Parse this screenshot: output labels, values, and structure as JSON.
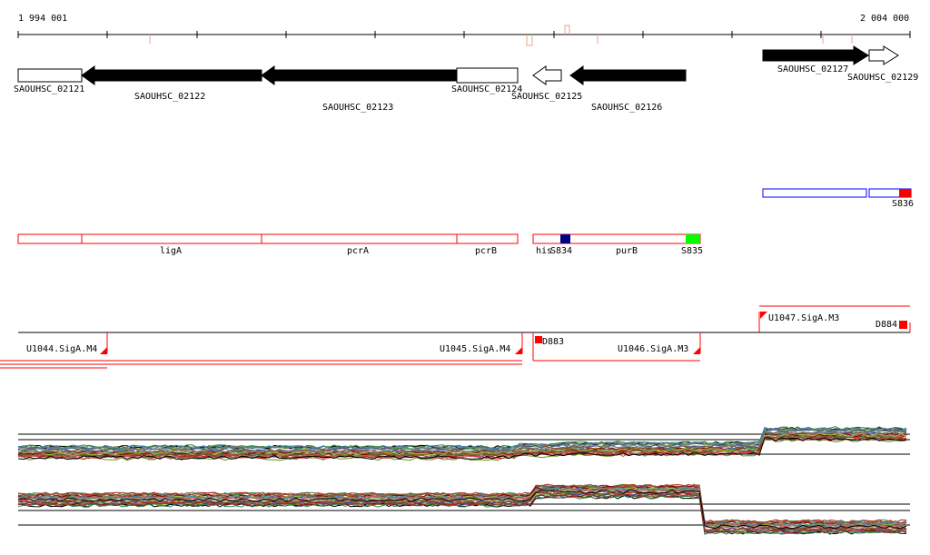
{
  "scale": {
    "start_label": "1 994 001",
    "end_label": "2 004 000",
    "start": 1994001,
    "end": 2004000
  },
  "colors": {
    "gene_fill": "#000000",
    "gene_outline": "#000000",
    "feature_red": "#ff0000",
    "feature_blue": "#0000ff",
    "feature_navy": "#000080",
    "feature_green": "#00ff00",
    "tick_salmon": "#e8a090"
  },
  "genes": [
    {
      "label": "SAOUHSC_02121",
      "strand": "+",
      "filled": false,
      "track": 0
    },
    {
      "label": "SAOUHSC_02122",
      "strand": "-",
      "filled": true,
      "track": 1
    },
    {
      "label": "SAOUHSC_02123",
      "strand": "-",
      "filled": true,
      "track": 2
    },
    {
      "label": "SAOUHSC_02124",
      "strand": "+",
      "filled": false,
      "track": 0
    },
    {
      "label": "SAOUHSC_02125",
      "strand": "-",
      "filled": false,
      "track": 1
    },
    {
      "label": "SAOUHSC_02126",
      "strand": "-",
      "filled": true,
      "track": 2
    },
    {
      "label": "SAOUHSC_02127",
      "strand": "+",
      "filled": true,
      "track": 0
    },
    {
      "label": "SAOUHSC_02129",
      "strand": "+",
      "filled": false,
      "track": 1
    }
  ],
  "operons": [
    {
      "labels": [
        "ligA",
        "pcrA",
        "pcrB"
      ]
    },
    {
      "labels": [
        "his",
        "S834",
        "purB",
        "S835"
      ]
    }
  ],
  "upper_features": [
    {
      "label": "S836"
    }
  ],
  "promoters": [
    {
      "label": "U1044.SigA.M4"
    },
    {
      "label": "U1045.SigA.M4"
    },
    {
      "label": "D883"
    },
    {
      "label": "U1046.SigA.M3"
    },
    {
      "label": "U1047.SigA.M3"
    },
    {
      "label": "D884"
    }
  ]
}
